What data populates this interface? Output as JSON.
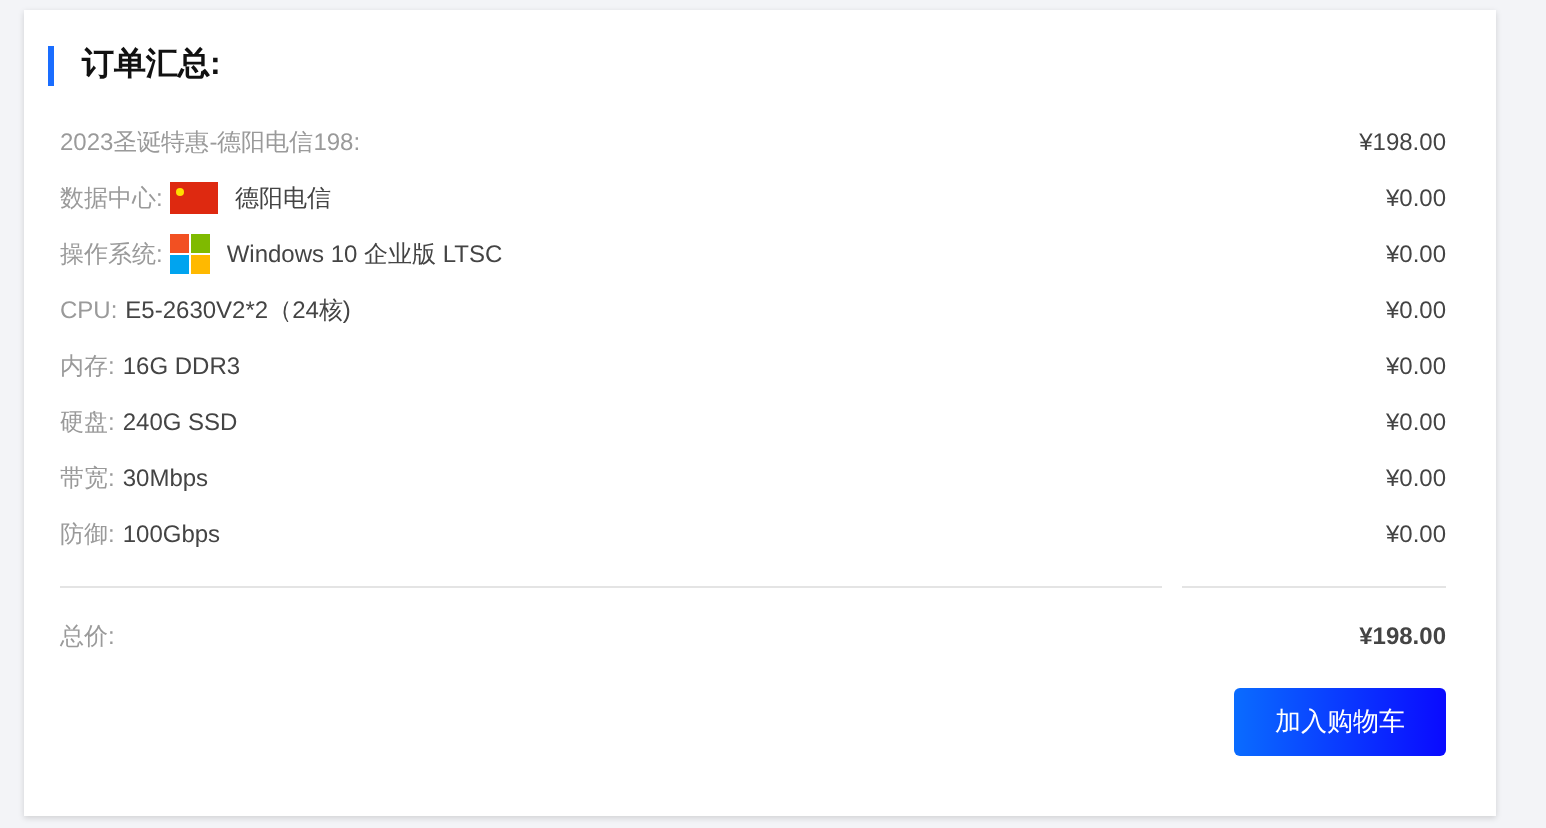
{
  "title": "订单汇总:",
  "items": [
    {
      "kind": "package",
      "label": "2023圣诞特惠-德阳电信198:",
      "price": "¥198.00"
    },
    {
      "kind": "datacenter",
      "label": "数据中心:",
      "value": "德阳电信",
      "price": "¥0.00"
    },
    {
      "kind": "system",
      "label": "操作系统:",
      "value": "Windows 10 企业版 LTSC",
      "price": "¥0.00"
    },
    {
      "kind": "spec",
      "label": "CPU:",
      "value": "E5-2630V2*2（24核)",
      "price": "¥0.00"
    },
    {
      "kind": "spec",
      "label": "内存:",
      "value": "16G DDR3",
      "price": "¥0.00"
    },
    {
      "kind": "spec",
      "label": "硬盘:",
      "value": "240G SSD",
      "price": "¥0.00"
    },
    {
      "kind": "spec",
      "label": "带宽:",
      "value": "30Mbps",
      "price": "¥0.00"
    },
    {
      "kind": "spec",
      "label": "防御:",
      "value": "100Gbps",
      "price": "¥0.00"
    }
  ],
  "total": {
    "label": "总价:",
    "price": "¥198.00"
  },
  "button": "加入购物车"
}
